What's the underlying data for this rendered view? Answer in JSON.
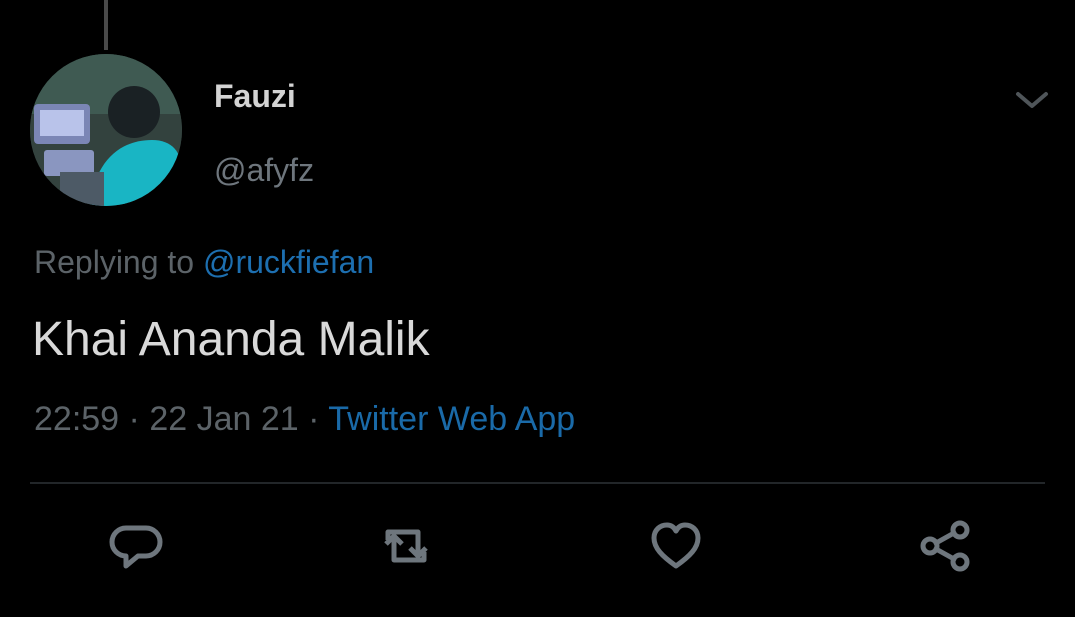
{
  "tweet": {
    "author": {
      "display_name": "Fauzi",
      "handle": "@afyfz"
    },
    "replying_prefix": "Replying to ",
    "replying_to": "@ruckfiefan",
    "text": "Khai Ananda Malik",
    "time": "22:59",
    "separator": " · ",
    "date": "22 Jan 21",
    "source": "Twitter Web App"
  },
  "actions": [
    "reply-icon",
    "retweet-icon",
    "like-icon",
    "share-icon"
  ],
  "colors": {
    "background": "#000000",
    "text": "#d9d9d9",
    "secondary_text": "#5c6368",
    "link": "#1d6fb0",
    "icon": "#6e767d"
  }
}
